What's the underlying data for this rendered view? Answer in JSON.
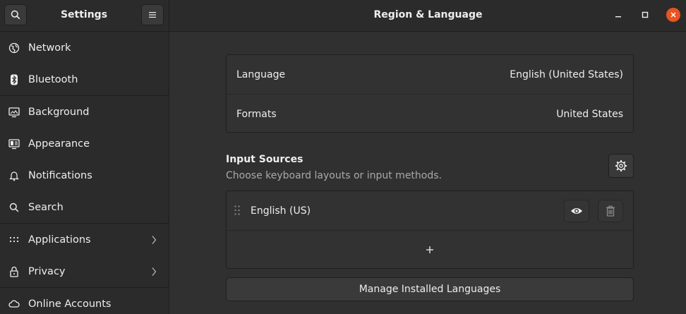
{
  "header": {
    "sidebar_title": "Settings",
    "main_title": "Region & Language",
    "search_icon": "search-icon",
    "menu_icon": "hamburger-menu-icon",
    "close_color": "#e95420"
  },
  "sidebar": {
    "items": [
      {
        "label": "Network",
        "icon": "network-icon"
      },
      {
        "label": "Bluetooth",
        "icon": "bluetooth-icon"
      },
      {
        "label": "Background",
        "icon": "background-icon"
      },
      {
        "label": "Appearance",
        "icon": "appearance-icon"
      },
      {
        "label": "Notifications",
        "icon": "bell-icon"
      },
      {
        "label": "Search",
        "icon": "search-icon"
      },
      {
        "label": "Applications",
        "icon": "applications-grid-icon",
        "has_submenu": true
      },
      {
        "label": "Privacy",
        "icon": "lock-icon",
        "has_submenu": true
      },
      {
        "label": "Online Accounts",
        "icon": "cloud-icon"
      }
    ]
  },
  "language": {
    "language_label": "Language",
    "language_value": "English (United States)",
    "formats_label": "Formats",
    "formats_value": "United States"
  },
  "input_sources": {
    "title": "Input Sources",
    "subtitle": "Choose keyboard layouts or input methods.",
    "sources": [
      {
        "label": "English (US)"
      }
    ],
    "add_symbol": "+"
  },
  "manage_button": "Manage Installed Languages"
}
